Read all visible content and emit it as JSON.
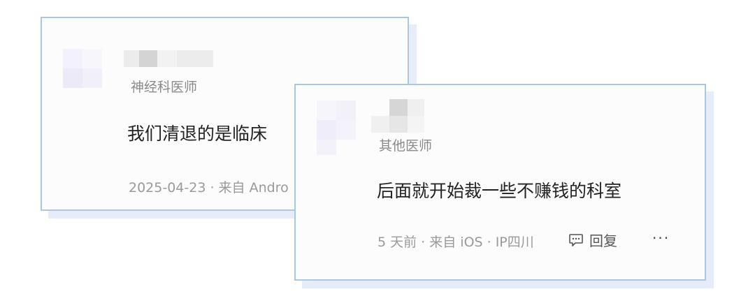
{
  "comments": [
    {
      "role": "神经科医师",
      "content": "我们清退的是临床",
      "meta": "2025-04-23 · 来自 Andro"
    },
    {
      "role": "其他医师",
      "content": "后面就开始裁一些不赚钱的科室",
      "meta": "5 天前 · 来自 iOS · IP四川",
      "reply_label": "回复",
      "more_label": "···"
    }
  ]
}
